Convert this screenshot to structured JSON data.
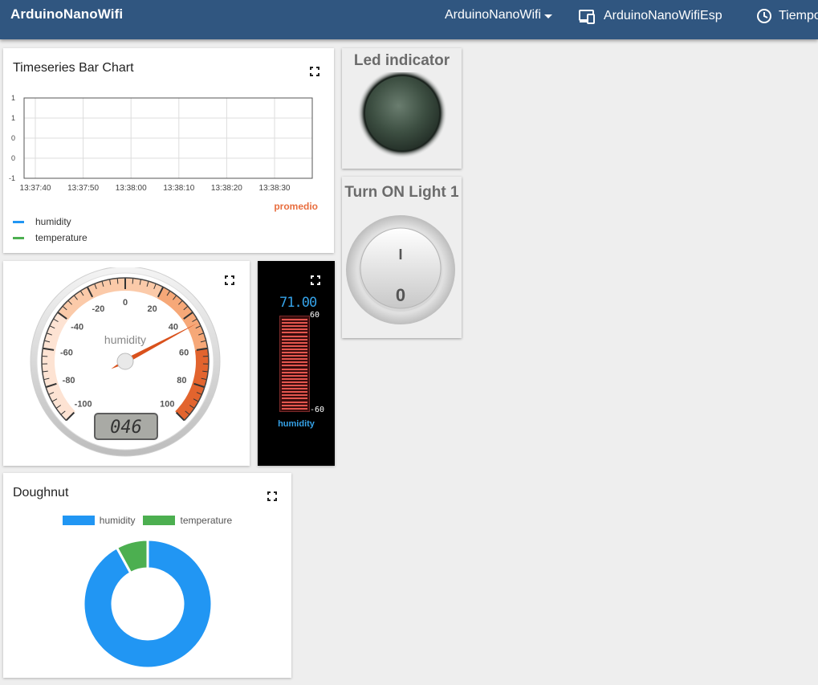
{
  "nav": {
    "brand": "ArduinoNanoWifi",
    "dashboard_select": "ArduinoNanoWifi",
    "entity_alias": "ArduinoNanoWifiEsp",
    "time_label": "Tiempo"
  },
  "timeseries_card": {
    "title": "Timeseries Bar Chart",
    "aggregation_label": "promedio",
    "fullscreen_icon": "fullscreen-icon",
    "chart_data": {
      "type": "bar",
      "title": "Timeseries Bar Chart",
      "x_ticks": [
        "13:37:40",
        "13:37:50",
        "13:38:00",
        "13:38:10",
        "13:38:20",
        "13:38:30"
      ],
      "y_ticks": [
        "1",
        "1",
        "0",
        "0",
        "-1"
      ],
      "ylim": [
        -1,
        1
      ],
      "grid": true,
      "legend_position": "bottom-left",
      "series": [
        {
          "name": "humidity",
          "color": "#2196f3",
          "values": []
        },
        {
          "name": "temperature",
          "color": "#4caf50",
          "values": []
        }
      ]
    }
  },
  "gauge_card": {
    "label": "humidity",
    "lcd_value": "046",
    "value": 46,
    "min": -100,
    "max": 100,
    "ticks": [
      "-100",
      "-80",
      "-60",
      "-40",
      "-20",
      "0",
      "20",
      "40",
      "60",
      "80",
      "100"
    ],
    "fullscreen_icon": "fullscreen-icon"
  },
  "thermometer_card": {
    "lcd_value": "71.00",
    "max_label": "60",
    "min_label": "-60",
    "label": "humidity",
    "fullscreen_icon": "fullscreen-icon"
  },
  "led_card": {
    "title": "Led indicator",
    "state": "off",
    "color": "#3d4f42"
  },
  "switch_card": {
    "title": "Turn ON Light 1",
    "on_label": "I",
    "off_label": "0",
    "state": "off"
  },
  "doughnut_card": {
    "title": "Doughnut",
    "fullscreen_icon": "fullscreen-icon",
    "chart_data": {
      "type": "pie",
      "title": "Doughnut",
      "legend_position": "top",
      "labels": [
        "humidity",
        "temperature"
      ],
      "values": [
        46,
        4
      ],
      "colors": [
        "#2196f3",
        "#4caf50"
      ]
    }
  }
}
